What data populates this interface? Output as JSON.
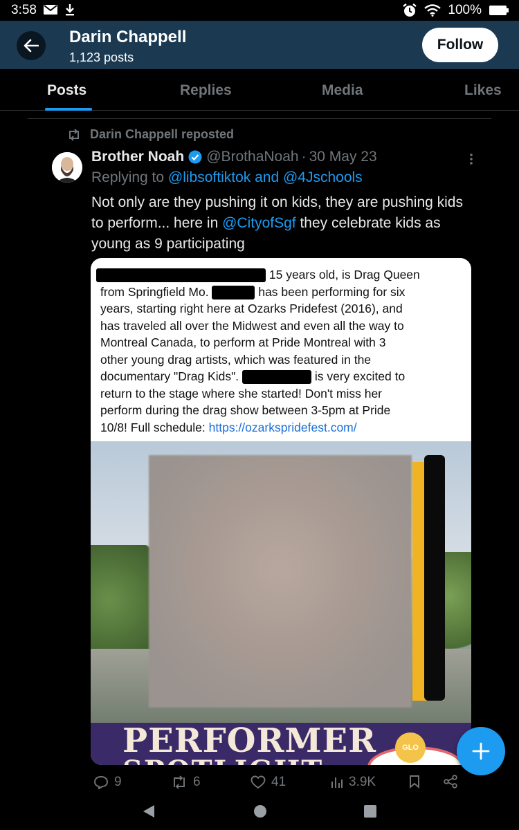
{
  "status_bar": {
    "time": "3:58",
    "battery": "100%"
  },
  "header": {
    "name": "Darin Chappell",
    "post_count": "1,123 posts",
    "follow_label": "Follow"
  },
  "tabs": [
    {
      "label": "Posts"
    },
    {
      "label": "Replies"
    },
    {
      "label": "Media"
    },
    {
      "label": "Likes"
    }
  ],
  "repost": {
    "text": "Darin Chappell reposted"
  },
  "tweet": {
    "author": "Brother Noah",
    "handle": "@BrothaNoah",
    "dot": "·",
    "date": "30 May 23",
    "replying_prefix": "Replying to",
    "replying_users": "@libsoftiktok and @4Jschools",
    "text_part1": "Not only are they pushing it on kids, they are pushing kids to perform... here in",
    "text_mention": "@CityofSgf",
    "text_part2": "they celebrate kids as young as 9 participating"
  },
  "media": {
    "line1": "15 years old, is Drag Queen",
    "line2a": "from Springfield Mo.",
    "line2b": "has been performing for six",
    "line3": "years, starting right here at Ozarks Pridefest (2016), and",
    "line4": "has traveled all over the Midwest and even all the way to",
    "line5": "Montreal Canada, to perform at Pride Montreal with 3",
    "line6": "other young drag artists, which was featured in the",
    "line7a": "documentary \"Drag Kids\".",
    "line7b": "is very excited to",
    "line8": "return to the stage where she started! Don't miss her",
    "line9": "perform during the drag show between 3-5pm at Pride",
    "line10a": "10/8! Full schedule:",
    "line10_link": "https://ozarkspridefest.com/",
    "banner_title": "PERFORMER",
    "banner_sub": "SPOTLIGHT",
    "badge_text": "GLO"
  },
  "actions": {
    "replies": "9",
    "reposts": "6",
    "likes": "41",
    "views": "3.9K"
  },
  "colors": {
    "accent": "#1d9bf0",
    "header_bg": "#1b3a52",
    "muted": "#71767b"
  }
}
